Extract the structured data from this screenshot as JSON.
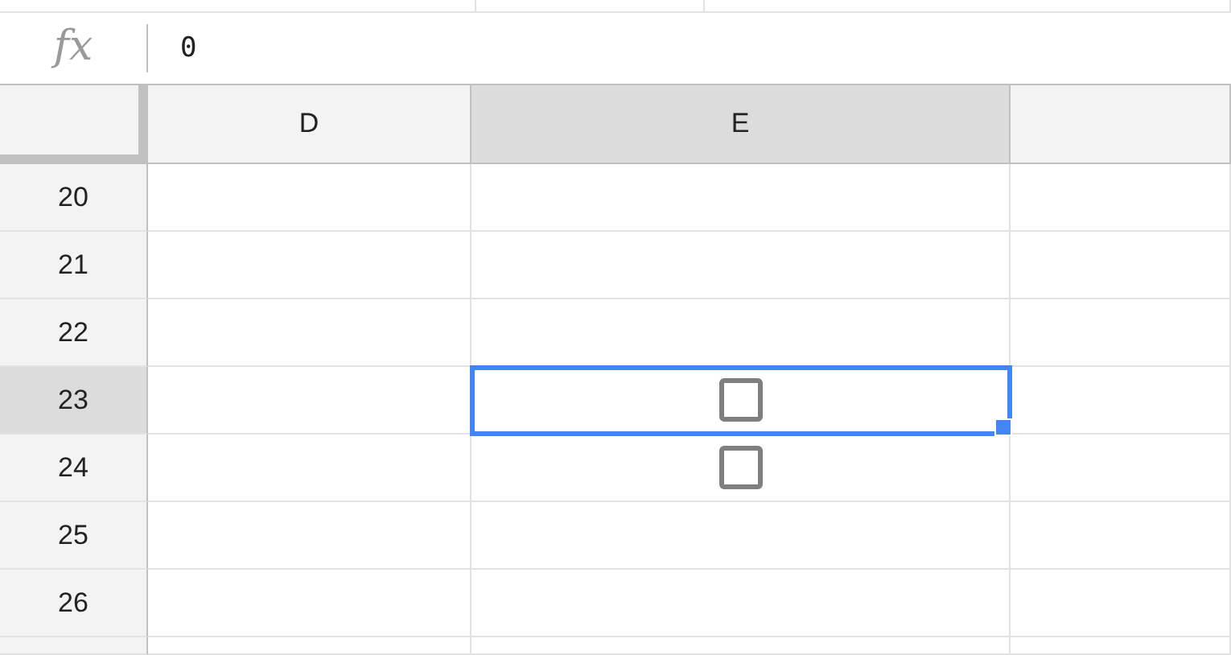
{
  "formula_bar": {
    "label": "fx",
    "value": "0"
  },
  "columns": [
    {
      "label": "D",
      "selected": false
    },
    {
      "label": "E",
      "selected": true
    }
  ],
  "rows": [
    {
      "number": "20",
      "selected": false,
      "cells": [
        {
          "kind": "empty",
          "selected": false
        },
        {
          "kind": "empty",
          "selected": false
        }
      ]
    },
    {
      "number": "21",
      "selected": false,
      "cells": [
        {
          "kind": "empty",
          "selected": false
        },
        {
          "kind": "empty",
          "selected": false
        }
      ]
    },
    {
      "number": "22",
      "selected": false,
      "cells": [
        {
          "kind": "empty",
          "selected": false
        },
        {
          "kind": "empty",
          "selected": false
        }
      ]
    },
    {
      "number": "23",
      "selected": true,
      "cells": [
        {
          "kind": "empty",
          "selected": false
        },
        {
          "kind": "checkbox",
          "checked": false,
          "selected": true
        }
      ]
    },
    {
      "number": "24",
      "selected": false,
      "cells": [
        {
          "kind": "empty",
          "selected": false
        },
        {
          "kind": "checkbox",
          "checked": false,
          "selected": false
        }
      ]
    },
    {
      "number": "25",
      "selected": false,
      "cells": [
        {
          "kind": "empty",
          "selected": false
        },
        {
          "kind": "empty",
          "selected": false
        }
      ]
    },
    {
      "number": "26",
      "selected": false,
      "cells": [
        {
          "kind": "empty",
          "selected": false
        },
        {
          "kind": "empty",
          "selected": false
        }
      ]
    }
  ]
}
